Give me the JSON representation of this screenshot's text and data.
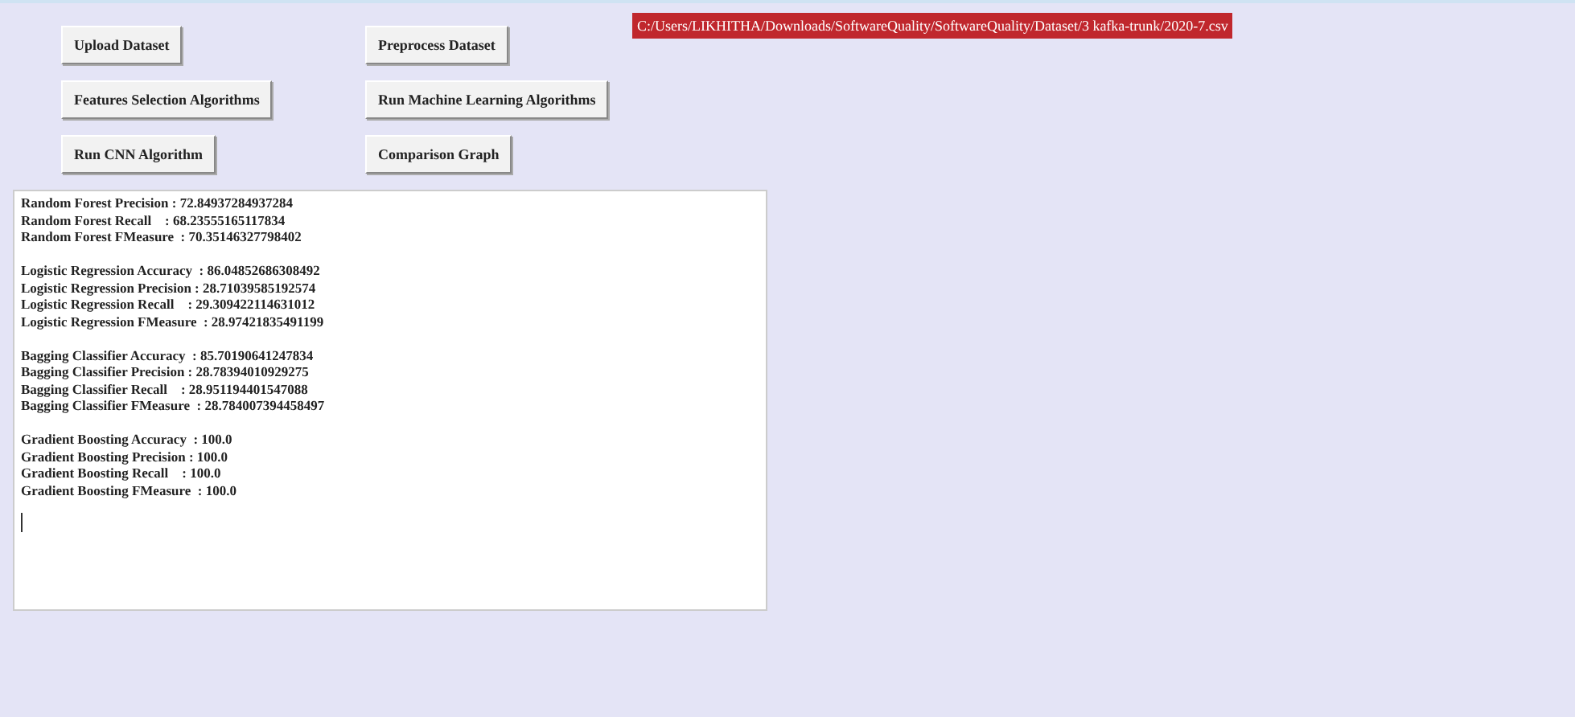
{
  "buttons": [
    {
      "label": "Upload Dataset"
    },
    {
      "label": "Preprocess Dataset"
    },
    {
      "label": "Features Selection Algorithms"
    },
    {
      "label": "Run Machine Learning Algorithms"
    },
    {
      "label": "Run CNN Algorithm"
    },
    {
      "label": "Comparison Graph"
    }
  ],
  "path_label": "C:/Users/LIKHITHA/Downloads/SoftwareQuality/SoftwareQuality/Dataset/3 kafka-trunk/2020-7.csv",
  "output_blocks": [
    {
      "lines": [
        "Random Forest Precision : 72.84937284937284",
        "Random Forest Recall    : 68.23555165117834",
        "Random Forest FMeasure  : 70.35146327798402"
      ]
    },
    {
      "lines": [
        "Logistic Regression Accuracy  : 86.04852686308492",
        "Logistic Regression Precision : 28.71039585192574",
        "Logistic Regression Recall    : 29.309422114631012",
        "Logistic Regression FMeasure  : 28.97421835491199"
      ]
    },
    {
      "lines": [
        "Bagging Classifier Accuracy  : 85.70190641247834",
        "Bagging Classifier Precision : 28.78394010929275",
        "Bagging Classifier Recall    : 28.951194401547088",
        "Bagging Classifier FMeasure  : 28.784007394458497"
      ]
    },
    {
      "lines": [
        "Gradient Boosting Accuracy  : 100.0",
        "Gradient Boosting Precision : 100.0",
        "Gradient Boosting Recall    : 100.0",
        "Gradient Boosting FMeasure  : 100.0"
      ]
    }
  ]
}
